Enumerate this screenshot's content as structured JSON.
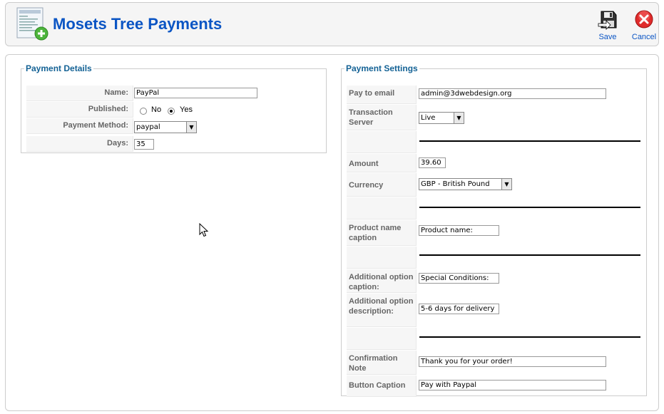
{
  "header": {
    "title": "Mosets Tree Payments",
    "save_label": "Save",
    "cancel_label": "Cancel",
    "icons": {
      "page": "document-add-icon",
      "save": "floppy-disk-icon",
      "cancel": "cancel-icon"
    }
  },
  "payment_details": {
    "legend": "Payment Details",
    "name_label": "Name:",
    "name_value": "PayPal",
    "published_label": "Published:",
    "published_no": "No",
    "published_yes": "Yes",
    "published_selected": "Yes",
    "method_label": "Payment Method:",
    "method_value": "paypal",
    "days_label": "Days:",
    "days_value": "35"
  },
  "payment_settings": {
    "legend": "Payment Settings",
    "pay_to_email_label": "Pay to email",
    "pay_to_email_value": "admin@3dwebdesign.org",
    "transaction_server_label": "Transaction Server",
    "transaction_server_value": "Live",
    "amount_label": "Amount",
    "amount_value": "39.60",
    "currency_label": "Currency",
    "currency_value": "GBP - British Pound",
    "product_name_caption_label": "Product name caption",
    "product_name_caption_value": "Product name:",
    "additional_option_caption_label": "Additional option caption:",
    "additional_option_caption_value": "Special Conditions:",
    "additional_option_description_label": "Additional option description:",
    "additional_option_description_value": "5-6 days for delivery",
    "confirmation_note_label": "Confirmation Note",
    "confirmation_note_value": "Thank you for your order!",
    "button_caption_label": "Button Caption",
    "button_caption_value": "Pay with Paypal"
  }
}
